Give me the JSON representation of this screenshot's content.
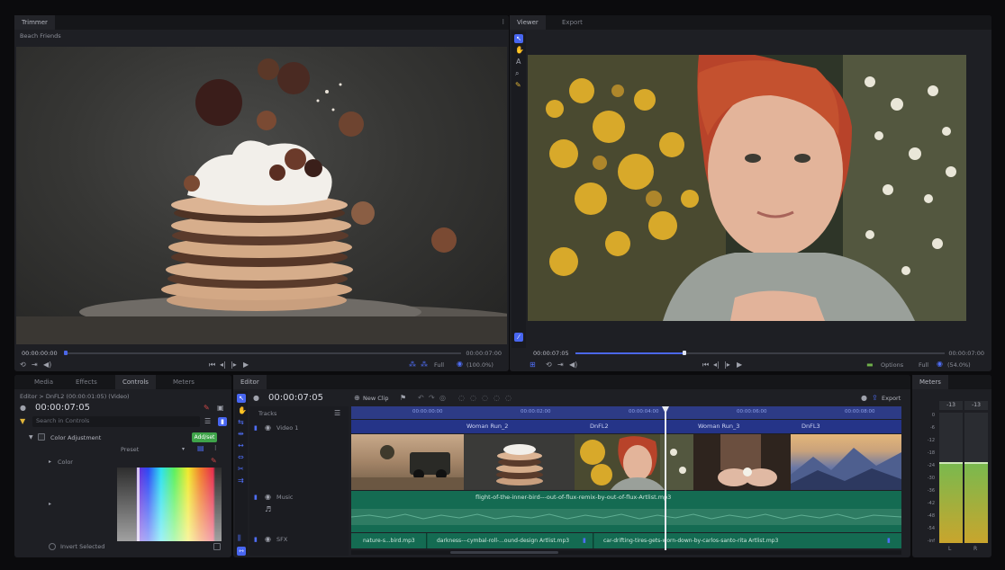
{
  "colors": {
    "accent": "#4a66f0",
    "audio": "#0f5a45",
    "audio_clip": "#2e7c63",
    "green": "#3fa44a",
    "meter_top": "#7ab94e",
    "meter_bottom": "#c9a52d"
  },
  "trimmer": {
    "tab": "Trimmer",
    "subtab": "Beach Friends",
    "time_current": "00:00:00:00",
    "time_total": "00:00:07:00",
    "quality": "Full",
    "zoom": "(100.0%)"
  },
  "viewer": {
    "tabs": [
      "Viewer",
      "Export"
    ],
    "time_current": "00:00:07:05",
    "time_total": "00:00:07:00",
    "options": "Options",
    "quality": "Full",
    "zoom": "(54.0%)"
  },
  "controls": {
    "tabs": [
      "Media",
      "Effects",
      "Controls",
      "Meters"
    ],
    "breadcrumb": "Editor > DnFL2 (00:00:01:05) (Video)",
    "time": "00:00:07:05",
    "search_placeholder": "Search in Controls",
    "effect_name": "Color Adjustment",
    "add_button": "Add/set",
    "preset_label": "Preset",
    "color_label": "Color",
    "invert_label": "Invert Selected"
  },
  "editor": {
    "tab": "Editor",
    "time": "00:00:07:05",
    "new_clip": "New Clip",
    "export": "Export",
    "tracks_label": "Tracks",
    "track_names": [
      "Video 1",
      "Music",
      "SFX"
    ],
    "ruler_labels": [
      "00:00:00:00",
      "00:00:02:00",
      "00:00:04:00",
      "00:00:06:00",
      "00:00:08:00"
    ],
    "video_clip_titles": [
      "Woman Run_2",
      "DnFL2",
      "Woman Run_3",
      "DnFL3"
    ],
    "music_clip": "flight-of-the-inner-bird---out-of-flux-remix-by-out-of-flux-Artlist.mp3",
    "sfx_clips": [
      "nature-s...bird.mp3",
      "darkness---cymbal-roll-...ound-design Artlist.mp3",
      "car-drifting-tires-gets-worn-down-by-carlos-santo-rita Artlist.mp3"
    ]
  },
  "meters": {
    "tab": "Meters",
    "peak_labels": [
      "-13",
      "-13"
    ],
    "scale": [
      "0",
      "-6",
      "-12",
      "-18",
      "-24",
      "-30",
      "-36",
      "-42",
      "-48",
      "-54",
      "-inf"
    ],
    "channels": [
      "L",
      "R"
    ],
    "levels": [
      0.62,
      0.62
    ]
  }
}
